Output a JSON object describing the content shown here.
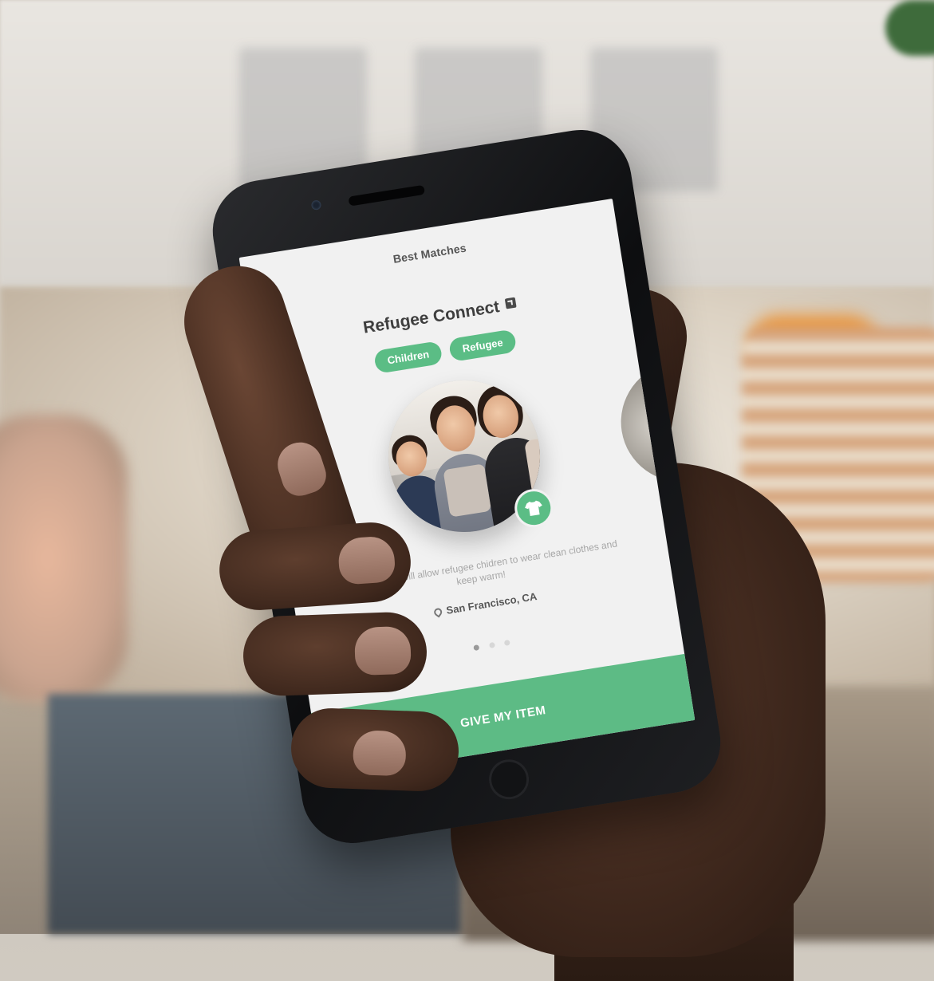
{
  "nav": {
    "back_glyph": "‹",
    "title": "Best Matches"
  },
  "organization": {
    "name": "Refugee Connect",
    "link_icon": "external-link-icon"
  },
  "tags": [
    "Children",
    "Refugee"
  ],
  "card": {
    "badge_icon": "tshirt-icon",
    "description": "Your donation will allow refugee chidren to wear clean clothes and keep warm!",
    "location": "San Francisco, CA",
    "location_icon": "location-pin-icon"
  },
  "pagination": {
    "total": 3,
    "active_index": 0
  },
  "cta": {
    "label": "GIVE MY ITEM"
  },
  "colors": {
    "accent": "#5dbb85",
    "text_dark": "#3e3e3e",
    "text_muted": "#a7a7a7",
    "screen_bg": "#f1f1f1"
  }
}
